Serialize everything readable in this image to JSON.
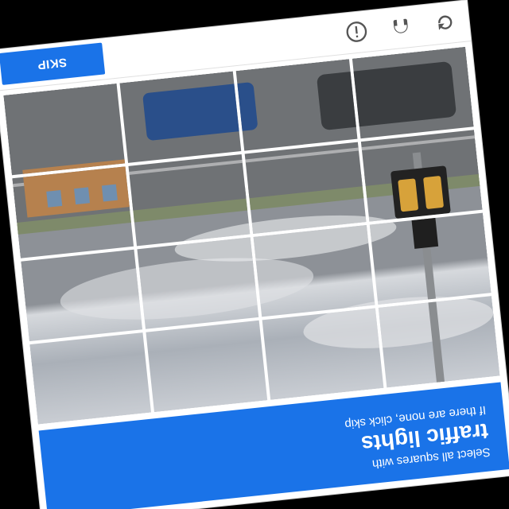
{
  "header": {
    "instruction_line1": "Select all squares with",
    "instruction_target": "traffic lights",
    "instruction_line3": "If there are none, click skip",
    "color": "#1a73e8"
  },
  "grid": {
    "rows": 4,
    "cols": 4,
    "tiles": [
      {
        "id": "r1c1"
      },
      {
        "id": "r1c2"
      },
      {
        "id": "r1c3"
      },
      {
        "id": "r1c4"
      },
      {
        "id": "r2c1"
      },
      {
        "id": "r2c2"
      },
      {
        "id": "r2c3"
      },
      {
        "id": "r2c4"
      },
      {
        "id": "r3c1"
      },
      {
        "id": "r3c2"
      },
      {
        "id": "r3c3"
      },
      {
        "id": "r3c4"
      },
      {
        "id": "r4c1"
      },
      {
        "id": "r4c2"
      },
      {
        "id": "r4c3"
      },
      {
        "id": "r4c4"
      }
    ]
  },
  "footer": {
    "skip_label": "SKIP",
    "icons": [
      "reload-icon",
      "audio-icon",
      "info-icon"
    ]
  },
  "orientation": "upside-down"
}
